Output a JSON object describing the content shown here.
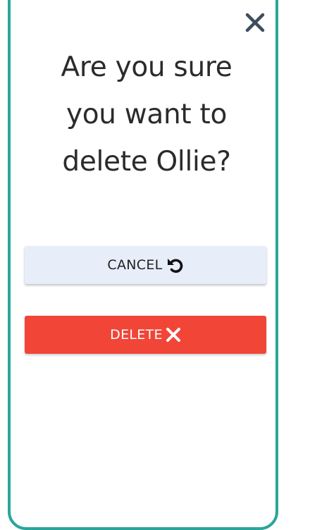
{
  "dialog": {
    "title": "Are you sure you want to delete Ollie?",
    "close_icon": "close-icon",
    "cancel_label": "CANCEL",
    "cancel_icon": "undo-icon",
    "delete_label": "DELETE",
    "delete_icon": "close-icon"
  },
  "colors": {
    "border": "#2aa59b",
    "close_icon": "#3e4d5c",
    "cancel_bg": "#e7eef9",
    "delete_bg": "#f14538",
    "text": "#2b2b2b"
  }
}
